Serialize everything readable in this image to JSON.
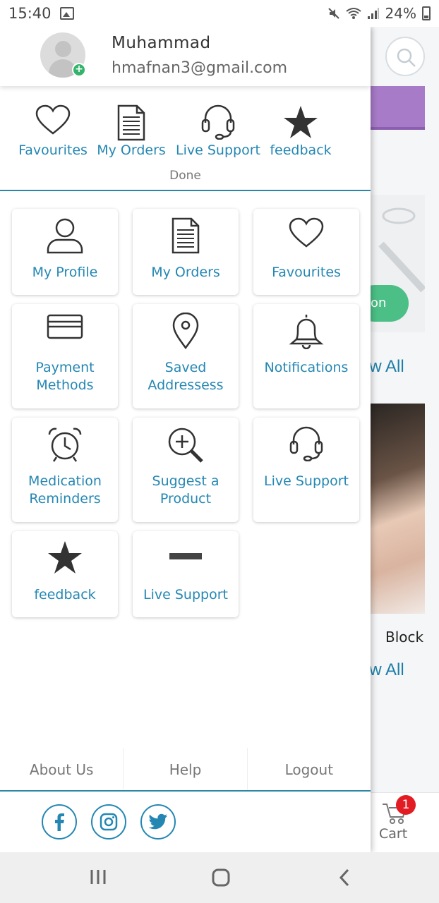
{
  "status_bar": {
    "time": "15:40",
    "battery": "24%"
  },
  "profile": {
    "name": "Muhammad",
    "email": "hmafnan3@gmail.com"
  },
  "quick_actions": {
    "items": [
      {
        "label": "Favourites",
        "icon": "heart-icon"
      },
      {
        "label": "My Orders",
        "icon": "document-icon"
      },
      {
        "label": "Live Support",
        "icon": "headset-icon"
      },
      {
        "label": "feedback",
        "icon": "star-icon"
      }
    ],
    "done_label": "Done"
  },
  "menu_tiles": [
    {
      "label": "My Profile",
      "icon": "person-icon"
    },
    {
      "label": "My Orders",
      "icon": "document-icon"
    },
    {
      "label": "Favourites",
      "icon": "heart-icon"
    },
    {
      "label": "Payment Methods",
      "icon": "credit-card-icon"
    },
    {
      "label": "Saved Addressess",
      "icon": "location-pin-icon"
    },
    {
      "label": "Notifications",
      "icon": "bell-icon"
    },
    {
      "label": "Medication Reminders",
      "icon": "alarm-clock-icon"
    },
    {
      "label": "Suggest a Product",
      "icon": "zoom-in-icon"
    },
    {
      "label": "Live Support",
      "icon": "headset-icon"
    },
    {
      "label": "feedback",
      "icon": "star-icon"
    },
    {
      "label": "Live Support",
      "icon": "minus-icon"
    }
  ],
  "footer": {
    "about": "About Us",
    "help": "Help",
    "logout": "Logout"
  },
  "social": [
    "facebook-icon",
    "instagram-icon",
    "twitter-icon"
  ],
  "background": {
    "pill_text": "on",
    "view_all_1": "ew All",
    "view_all_2": "ew All",
    "product_label": "Block",
    "cart_label": "Cart",
    "cart_count": "1"
  },
  "colors": {
    "accent": "#2487b3",
    "badge": "#e31b23",
    "online": "#34b36b"
  }
}
